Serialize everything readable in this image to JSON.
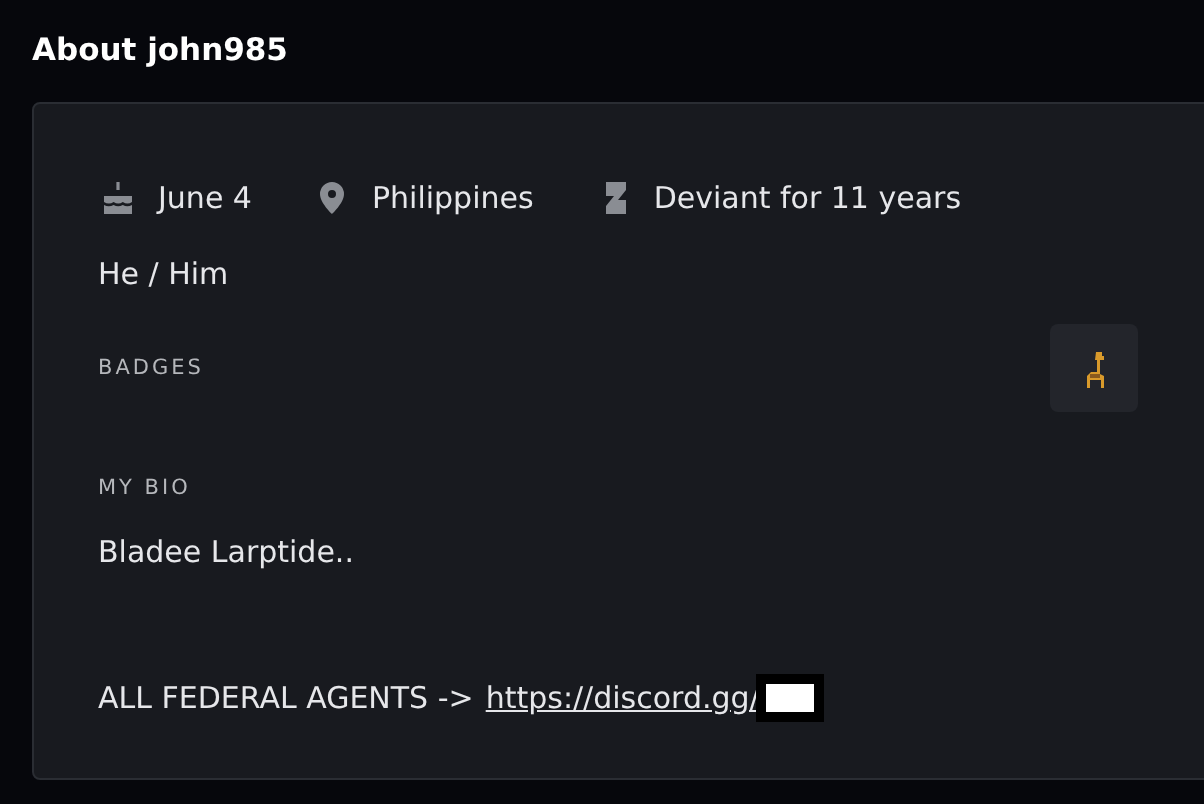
{
  "title": "About john985",
  "facts": [
    {
      "kind": "birthday",
      "text": "June 4"
    },
    {
      "kind": "location",
      "text": "Philippines"
    },
    {
      "kind": "membership",
      "text": "Deviant for 11 years"
    }
  ],
  "pronouns": "He / Him",
  "badges": {
    "label": "BADGES",
    "items": [
      {
        "kind": "llama"
      }
    ]
  },
  "bio": {
    "label": "MY BIO",
    "lines": [
      {
        "text": "Bladee Larptide.."
      },
      {
        "text": "ALL FEDERAL AGENTS ->",
        "link": "https://discord.gg/",
        "redacted": true
      }
    ]
  }
}
